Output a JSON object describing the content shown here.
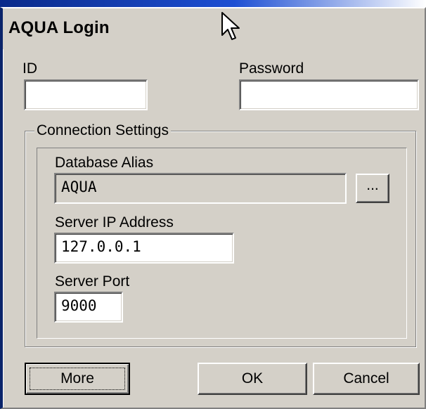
{
  "window": {
    "title": "AQUA Login"
  },
  "login": {
    "id_label": "ID",
    "id_value": "",
    "password_label": "Password",
    "password_value": ""
  },
  "connection": {
    "group_label": "Connection Settings",
    "alias_label": "Database Alias",
    "alias_value": "AQUA",
    "browse_label": "...",
    "ip_label": "Server IP Address",
    "ip_value": "127.0.0.1",
    "port_label": "Server Port",
    "port_value": "9000"
  },
  "buttons": {
    "more_label": "More",
    "ok_label": "OK",
    "cancel_label": "Cancel"
  },
  "colors": {
    "face": "#d4d0c8",
    "window_accent": "#0a246a",
    "input_bg": "#ffffff"
  },
  "icons": {
    "cursor": "mouse-pointer-arrow-icon"
  }
}
